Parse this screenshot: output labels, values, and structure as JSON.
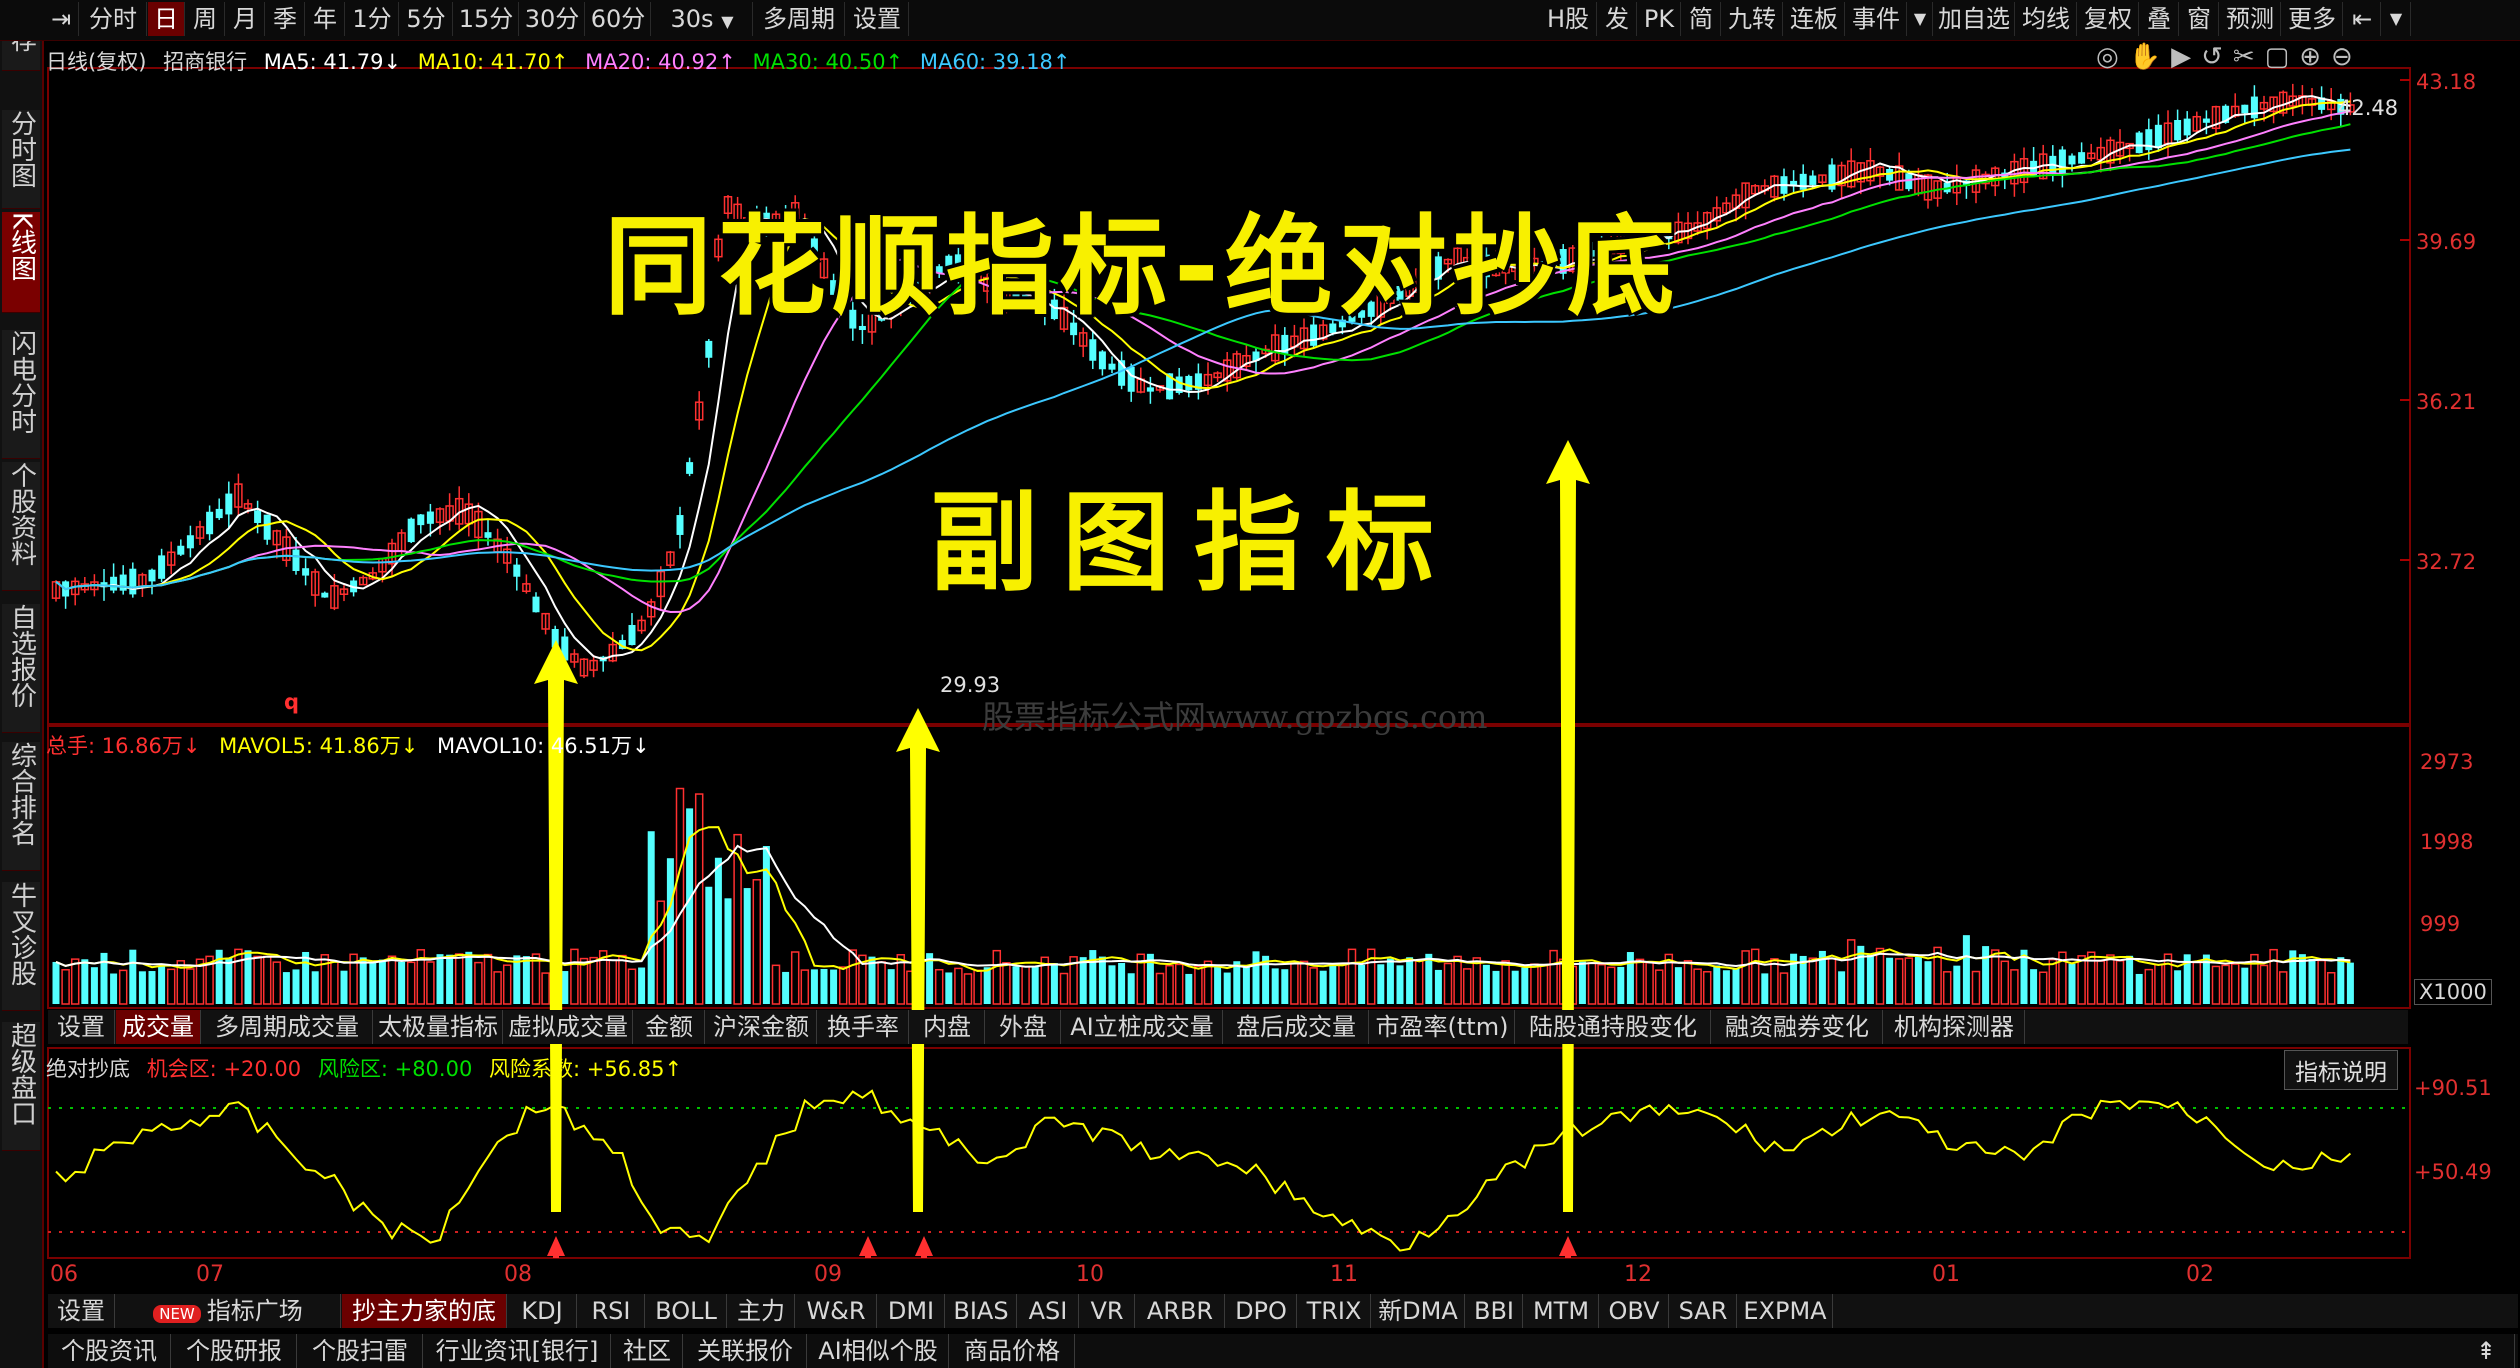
{
  "toolbar": {
    "left_items": [
      "分时",
      "日",
      "周",
      "月",
      "季",
      "年",
      "1分",
      "5分",
      "15分",
      "30分",
      "60分",
      "30s",
      "多周期",
      "设置"
    ],
    "right_items": [
      "H股",
      "发",
      "PK",
      "简",
      "九转",
      "连板",
      "事件",
      "加自选",
      "均线",
      "复权",
      "叠",
      "窗",
      "预测",
      "更多"
    ]
  },
  "sidebar": {
    "items": [
      "推荐",
      "分时图",
      "K线图",
      "闪电分时",
      "个股资料",
      "自选报价",
      "综合排名",
      "牛叉诊股",
      "超级盘口"
    ]
  },
  "kline": {
    "header": {
      "period": "日线(复权)",
      "stock": "招商银行",
      "ma5": "MA5: 41.79↓",
      "ma10": "MA10: 41.70↑",
      "ma20": "MA20: 40.92↑",
      "ma30": "MA30: 40.50↑",
      "ma60": "MA60: 39.18↑"
    },
    "y_labels": [
      "43.18",
      "39.69",
      "36.21",
      "32.72"
    ],
    "high_label": "42.48",
    "low_label": "29.93",
    "q_marker": "q",
    "watermark": "股票指标公式网www.gpzbgs.com",
    "overlay_title": "同花顺指标-绝对抄底",
    "overlay_subtitle": "副图指标"
  },
  "volume": {
    "header": {
      "total": "总手: 16.86万↓",
      "mavol5": "MAVOL5: 41.86万↓",
      "mavol10": "MAVOL10: 46.51万↓"
    },
    "y_labels": [
      "2973",
      "1998",
      "999"
    ],
    "unit": "X1000"
  },
  "mid_tabs": [
    "设置",
    "成交量",
    "多周期成交量",
    "太极量指标",
    "虚拟成交量",
    "金额",
    "沪深金额",
    "换手率",
    "内盘",
    "外盘",
    "AI立桩成交量",
    "盘后成交量",
    "市盈率(ttm)",
    "陆股通持股变化",
    "融资融券变化",
    "机构探测器"
  ],
  "indicator": {
    "name": "绝对抄底",
    "opp_label": "机会区: +20.00",
    "risk_label": "风险区: +80.00",
    "coef_label": "风险系数: +56.85↑",
    "explain_button": "指标说明",
    "y_labels": [
      "+90.51",
      "+50.49"
    ]
  },
  "x_labels": [
    "06",
    "07",
    "08",
    "09",
    "10",
    "11",
    "12",
    "01",
    "02"
  ],
  "bottom_tabs1": [
    "设置",
    "NEW",
    "指标广场",
    "抄主力家的底",
    "KDJ",
    "RSI",
    "BOLL",
    "主力",
    "W&R",
    "DMI",
    "BIAS",
    "ASI",
    "VR",
    "ARBR",
    "DPO",
    "TRIX",
    "新DMA",
    "BBI",
    "MTM",
    "OBV",
    "SAR",
    "EXPMA"
  ],
  "bottom_tabs2": [
    "个股资讯",
    "个股研报",
    "个股扫雷",
    "行业资讯[银行]",
    "社区",
    "关联报价",
    "AI相似个股",
    "商品价格"
  ],
  "colors": {
    "up": "#ff3030",
    "down": "#54ffff",
    "ma5": "#ffffff",
    "ma10": "#ffff00",
    "ma20": "#ff80ff",
    "ma30": "#00e000",
    "ma60": "#3cc8ff",
    "arrow": "#ffff00",
    "accent_red": "#6a0000"
  }
}
